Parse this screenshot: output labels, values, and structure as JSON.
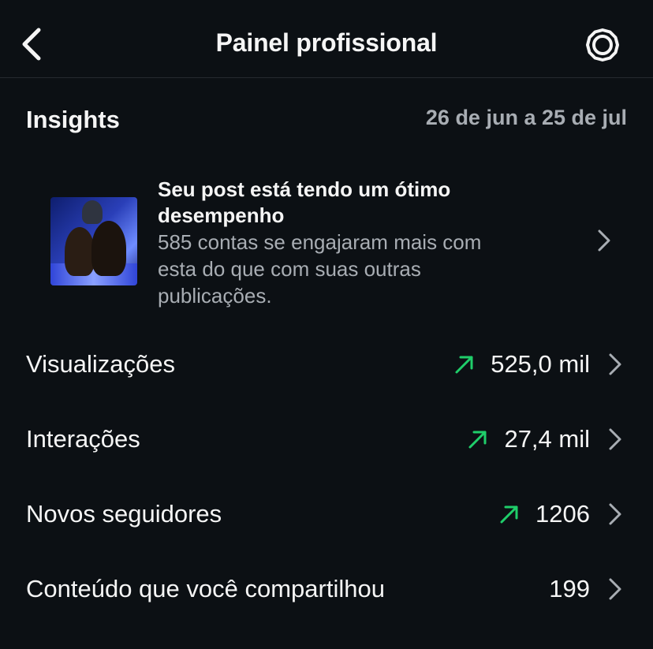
{
  "header": {
    "title": "Painel profissional",
    "back_icon": "chevron-left-icon",
    "settings_icon": "gear-icon"
  },
  "insights": {
    "title": "Insights",
    "date_range": "26 de jun a 25 de jul"
  },
  "post_card": {
    "headline_line1": "Seu post está tendo um ótimo",
    "headline_line2": "desempenho",
    "desc_line1": "585 contas se engajaram mais com",
    "desc_line2": "esta do que com suas outras",
    "desc_line3": "publicações."
  },
  "metrics": [
    {
      "label": "Visualizações",
      "value": "525,0 mil",
      "trend": "up"
    },
    {
      "label": "Interações",
      "value": "27,4 mil",
      "trend": "up"
    },
    {
      "label": "Novos seguidores",
      "value": "1206",
      "trend": "up"
    },
    {
      "label": "Conteúdo que você compartilhou",
      "value": "199",
      "trend": "none"
    }
  ],
  "colors": {
    "background": "#0c1014",
    "text_primary": "#f5f5f5",
    "text_secondary": "#a8adb3",
    "trend_up": "#1fce6a"
  }
}
